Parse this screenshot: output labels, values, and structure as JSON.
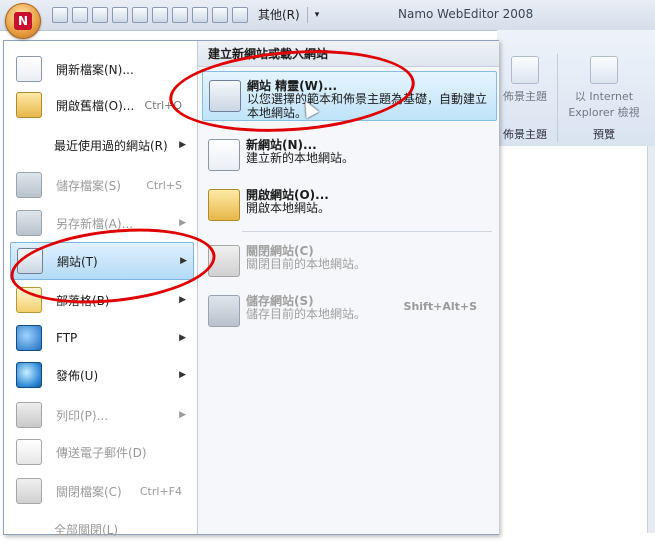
{
  "app_title": "Namo WebEditor 2008",
  "qat_other": "其他(R)",
  "ribbon": {
    "bg_theme_label": "佈景主題",
    "bg_theme_group": "佈景主題",
    "ie_preview_label": "以 Internet Explorer 檢視",
    "preview_group": "預覽"
  },
  "left_menu": [
    {
      "label": "開新檔案(N)...",
      "shortcut": "",
      "arrow": false,
      "disabled": false,
      "selected": false,
      "icon": "new-file-icon"
    },
    {
      "label": "開啟舊檔(O)...",
      "shortcut": "Ctrl+O",
      "arrow": false,
      "disabled": false,
      "selected": false,
      "icon": "open-folder-icon"
    },
    {
      "label": "最近使用過的網站(R)",
      "shortcut": "",
      "arrow": true,
      "disabled": false,
      "selected": false,
      "icon": ""
    },
    {
      "label": "儲存檔案(S)",
      "shortcut": "Ctrl+S",
      "arrow": false,
      "disabled": true,
      "selected": false,
      "icon": "save-disk-icon"
    },
    {
      "label": "另存新檔(A)...",
      "shortcut": "",
      "arrow": true,
      "disabled": true,
      "selected": false,
      "icon": "save-as-icon"
    },
    {
      "label": "網站(T)",
      "shortcut": "",
      "arrow": true,
      "disabled": false,
      "selected": true,
      "icon": "website-icon"
    },
    {
      "label": "部落格(B)",
      "shortcut": "",
      "arrow": true,
      "disabled": false,
      "selected": false,
      "icon": "blog-icon"
    },
    {
      "label": "FTP",
      "shortcut": "",
      "arrow": true,
      "disabled": false,
      "selected": false,
      "icon": "ftp-icon"
    },
    {
      "label": "發佈(U)",
      "shortcut": "",
      "arrow": true,
      "disabled": false,
      "selected": false,
      "icon": "globe-icon"
    },
    {
      "label": "列印(P)...",
      "shortcut": "",
      "arrow": true,
      "disabled": true,
      "selected": false,
      "icon": "printer-icon"
    },
    {
      "label": "傳送電子郵件(D)",
      "shortcut": "",
      "arrow": false,
      "disabled": true,
      "selected": false,
      "icon": "mail-icon"
    },
    {
      "label": "關閉檔案(C)",
      "shortcut": "Ctrl+F4",
      "arrow": false,
      "disabled": true,
      "selected": false,
      "icon": "close-file-icon"
    },
    {
      "label": "全部關閉(L)",
      "shortcut": "",
      "arrow": false,
      "disabled": true,
      "selected": false,
      "icon": ""
    }
  ],
  "right_pane": {
    "header": "建立新網站或載入網站",
    "items": [
      {
        "title": "網站 精靈(W)...",
        "desc": "以您選擇的範本和佈景主題為基礎，自動建立本地網站。",
        "shortcut": "",
        "disabled": false,
        "selected": true,
        "icon": "site-wizard-icon"
      },
      {
        "title": "新網站(N)...",
        "desc": "建立新的本地網站。",
        "shortcut": "",
        "disabled": false,
        "selected": false,
        "icon": "new-site-icon"
      },
      {
        "title": "開啟網站(O)...",
        "desc": "開啟本地網站。",
        "shortcut": "",
        "disabled": false,
        "selected": false,
        "icon": "open-site-icon"
      },
      {
        "title": "關閉網站(C)",
        "desc": "關閉目前的本地網站。",
        "shortcut": "",
        "disabled": true,
        "selected": false,
        "icon": "close-site-icon"
      },
      {
        "title": "儲存網站(S)",
        "desc": "儲存目前的本地網站。",
        "shortcut": "Shift+Alt+S",
        "disabled": true,
        "selected": false,
        "icon": "save-site-icon"
      }
    ]
  },
  "colors": {
    "annotation_circle": "#e00000",
    "selection": "#b3dbf6"
  }
}
